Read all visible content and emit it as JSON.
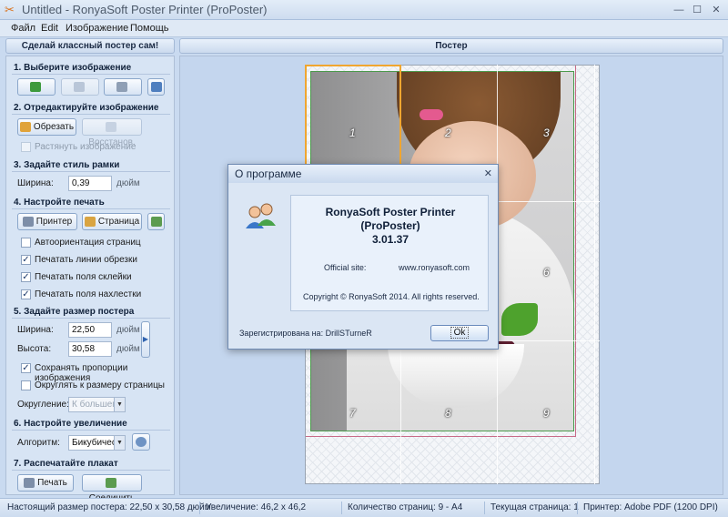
{
  "window": {
    "title": "Untitled - RonyaSoft Poster Printer (ProPoster)",
    "minimize": "—",
    "maximize": "☐",
    "close": "✕"
  },
  "menu": [
    "Файл",
    "Edit",
    "Изображение",
    "Помощь"
  ],
  "headers": {
    "left": "Сделай классный постер сам!",
    "right": "Постер"
  },
  "sections": {
    "s1": "1. Выберите изображение",
    "s2": "2. Отредактируйте изображение",
    "s3": "3. Задайте стиль рамки",
    "s4": "4. Настройте печать",
    "s5": "5. Задайте размер постера",
    "s6": "6. Настройте увеличение",
    "s7": "7. Распечатайте плакат"
  },
  "edit": {
    "crop": "Обрезать",
    "restore": "Восстанов.",
    "stretch": "Растянуть изображение"
  },
  "frame": {
    "width_label": "Ширина:",
    "width_value": "0,39",
    "unit": "дюйм"
  },
  "print_setup": {
    "printer": "Принтер",
    "page": "Страница",
    "auto_orient": "Автоориентация страниц",
    "cut_lines": "Печатать линии обрезки",
    "glue_margins": "Печатать поля склейки",
    "overlap_margins": "Печатать поля нахлестки"
  },
  "size": {
    "width_label": "Ширина:",
    "width_value": "22,50",
    "height_label": "Высота:",
    "height_value": "30,58",
    "unit": "дюйм",
    "keep_ratio": "Сохранять пропорции изображения",
    "round_page": "Округлять к размеру страницы",
    "rounding_label": "Округление:",
    "rounding_value": "К большем"
  },
  "zoom": {
    "algo_label": "Алгоритм:",
    "algo_value": "Бикубичеси"
  },
  "output": {
    "print": "Печать",
    "join": "Соединить"
  },
  "pages": [
    "1",
    "2",
    "3",
    "6",
    "7",
    "8",
    "9"
  ],
  "dialog": {
    "title": "О программе",
    "close": "✕",
    "product_line1": "RonyaSoft Poster Printer",
    "product_line2": "(ProPoster)",
    "version": "3.01.37",
    "site_label": "Official site:",
    "site_url": "www.ronyasoft.com",
    "copyright": "Copyright © RonyaSoft 2014.  All rights reserved.",
    "registered": "Зарегистрирована на: DrillSTurneR",
    "ok": "Ok"
  },
  "status": {
    "actual_size": "Настоящий размер постера: 22,50 x 30,58 дюйм",
    "zoom": "Увеличение: 46,2 x 46,2",
    "page_count": "Количество страниц: 9 - A4",
    "current_page": "Текущая страница: 1",
    "printer": "Принтер: Adobe PDF (1200 DPI)"
  }
}
